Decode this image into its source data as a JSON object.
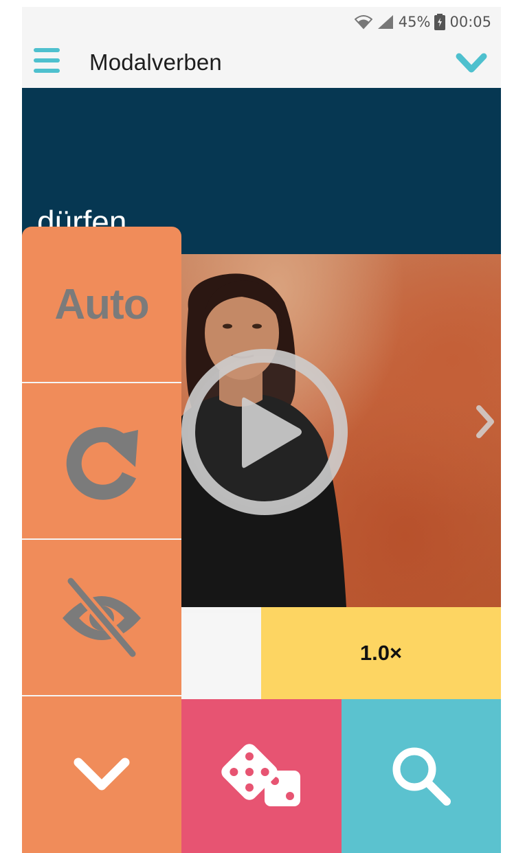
{
  "status_bar": {
    "battery_text": "45%",
    "time": "00:05"
  },
  "app_bar": {
    "title": "Modalverben",
    "menu_icon": "hamburger-menu-icon",
    "dropdown_icon": "chevron-down-icon"
  },
  "word_banner": {
    "word": "dürfen"
  },
  "video": {
    "play_icon": "play-circle-icon",
    "next_icon": "chevron-right-icon"
  },
  "speed": {
    "label": "1.0×"
  },
  "side_menu": {
    "auto_label": "Auto",
    "replay_icon": "replay-icon",
    "hide_icon": "eye-off-icon",
    "collapse_icon": "chevron-down-icon"
  },
  "bottom_bar": {
    "random_icon": "dice-icon",
    "search_icon": "search-icon"
  },
  "colors": {
    "accent_teal": "#4ec0ce",
    "banner_navy": "#063752",
    "side_orange": "#f08c5a",
    "speed_yellow": "#fdd562",
    "dice_pink": "#e75472",
    "search_teal": "#5bc2cf"
  }
}
